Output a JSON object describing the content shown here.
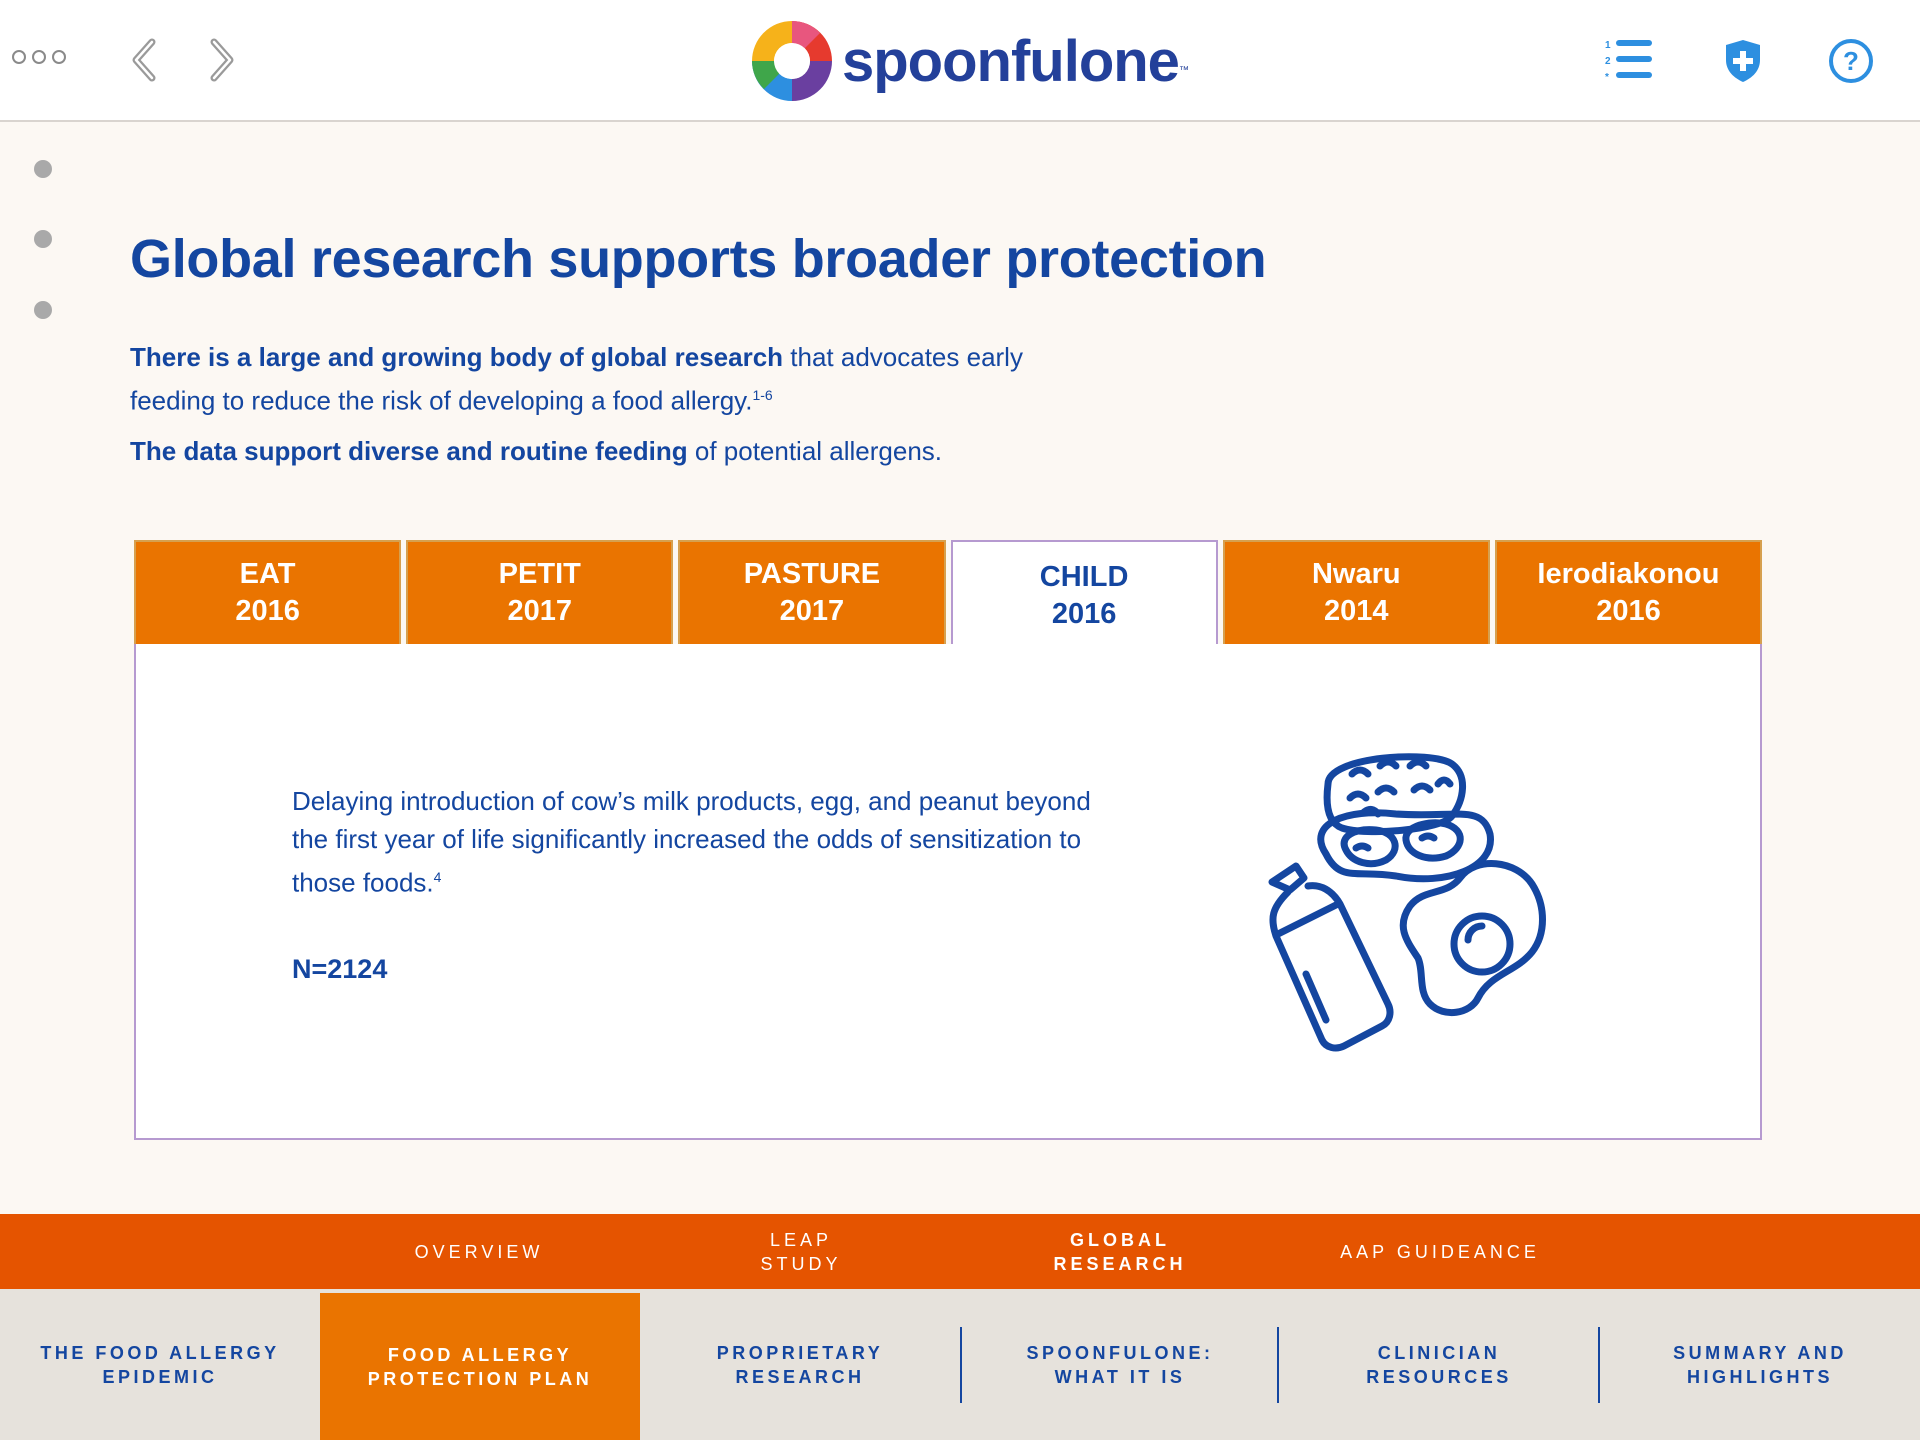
{
  "header": {
    "logo_text": "spoonfulone",
    "logo_tm": "™",
    "icons": [
      "more-dots-icon",
      "back-arrow-icon",
      "forward-arrow-icon",
      "numbered-list-icon",
      "shield-plus-icon",
      "help-icon"
    ]
  },
  "page": {
    "title": "Global research supports broader protection",
    "intro1_bold": "There is a large and growing body of global research",
    "intro1_rest": " that advocates early feeding to reduce the risk of developing a food allergy.",
    "intro1_sup": "1-6",
    "intro2_bold": "The data support diverse and routine feeding",
    "intro2_rest": " of potential allergens."
  },
  "tabs": [
    {
      "name": "EAT",
      "year": "2016"
    },
    {
      "name": "PETIT",
      "year": "2017"
    },
    {
      "name": "PASTURE",
      "year": "2017"
    },
    {
      "name": "CHILD",
      "year": "2016"
    },
    {
      "name": "Nwaru",
      "year": "2014"
    },
    {
      "name": "Ierodiakonou",
      "year": "2016"
    }
  ],
  "active_tab": "CHILD 2016",
  "panel": {
    "text": "Delaying introduction of cow’s milk products, egg, and peanut beyond the first year of life significantly increased the odds of sensitization to those foods.",
    "sup": "4",
    "n": "N=2124",
    "icon": "allergen-foods-icon"
  },
  "section_nav": [
    {
      "label": "OVERVIEW"
    },
    {
      "label": "LEAP STUDY"
    },
    {
      "label": "GLOBAL RESEARCH"
    },
    {
      "label": "AAP GUIDEANCE"
    }
  ],
  "bottom_nav": [
    {
      "label": "THE FOOD ALLERGY EPIDEMIC"
    },
    {
      "label": "FOOD ALLERGY PROTECTION PLAN"
    },
    {
      "label": "PROPRIETARY RESEARCH"
    },
    {
      "label": "SPOONFULONE: WHAT IT IS"
    },
    {
      "label": "CLINICIAN RESOURCES"
    },
    {
      "label": "SUMMARY AND HIGHLIGHTS"
    }
  ],
  "colors": {
    "brand_blue": "#1446a0",
    "tab_orange": "#ea7400",
    "section_orange": "#e55400",
    "icon_blue": "#2d8fe0",
    "background": "#fcf8f3"
  }
}
